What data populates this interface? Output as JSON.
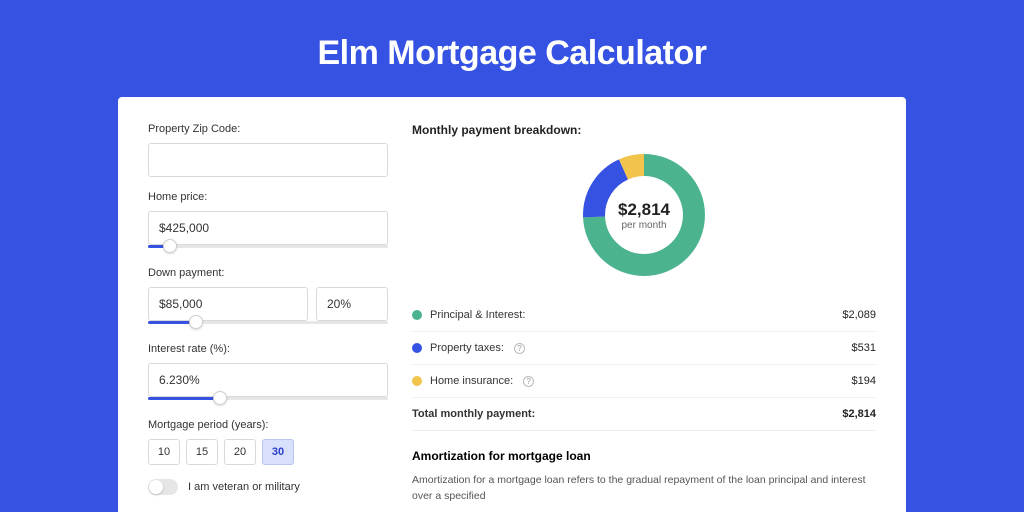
{
  "title": "Elm Mortgage Calculator",
  "form": {
    "zip_label": "Property Zip Code:",
    "zip_value": "",
    "home_price_label": "Home price:",
    "home_price_value": "$425,000",
    "home_price_slider": {
      "fill_pct": 9,
      "thumb_pct": 9
    },
    "down_payment_label": "Down payment:",
    "down_payment_value": "$85,000",
    "down_payment_pct": "20%",
    "down_payment_slider": {
      "fill_pct": 20,
      "thumb_pct": 20
    },
    "interest_label": "Interest rate (%):",
    "interest_value": "6.230%",
    "interest_slider": {
      "fill_pct": 30,
      "thumb_pct": 30
    },
    "period_label": "Mortgage period (years):",
    "periods": [
      "10",
      "15",
      "20",
      "30"
    ],
    "period_active": "30",
    "veteran_label": "I am veteran or military",
    "veteran_on": false
  },
  "breakdown": {
    "title": "Monthly payment breakdown:",
    "center_amount": "$2,814",
    "center_sub": "per month",
    "items": [
      {
        "label": "Principal & Interest:",
        "value": "$2,089",
        "color": "#4bb48e",
        "info": false
      },
      {
        "label": "Property taxes:",
        "value": "$531",
        "color": "#3652e3",
        "info": true
      },
      {
        "label": "Home insurance:",
        "value": "$194",
        "color": "#f2c44b",
        "info": true
      }
    ],
    "total_label": "Total monthly payment:",
    "total_value": "$2,814"
  },
  "chart_data": {
    "type": "pie",
    "title": "Monthly payment breakdown",
    "series": [
      {
        "name": "Principal & Interest",
        "value": 2089,
        "color": "#4bb48e"
      },
      {
        "name": "Property taxes",
        "value": 531,
        "color": "#3652e3"
      },
      {
        "name": "Home insurance",
        "value": 194,
        "color": "#f2c44b"
      }
    ],
    "total": 2814
  },
  "amort": {
    "title": "Amortization for mortgage loan",
    "text": "Amortization for a mortgage loan refers to the gradual repayment of the loan principal and interest over a specified"
  }
}
